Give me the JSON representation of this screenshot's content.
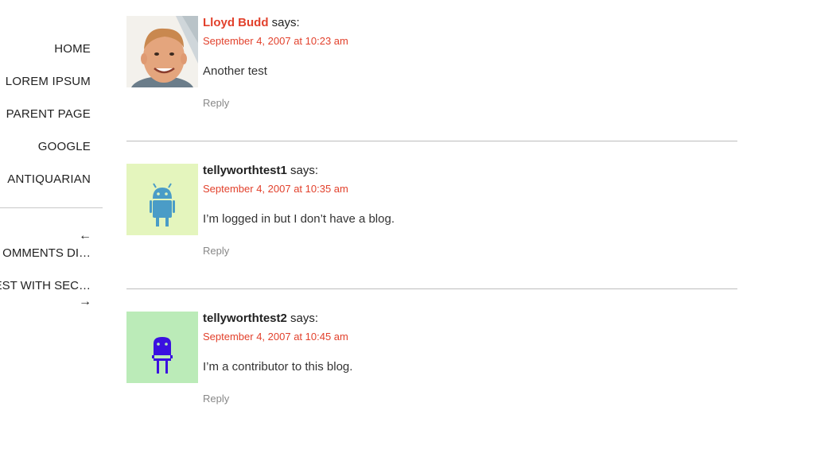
{
  "nav": {
    "items": [
      "HOME",
      "LOREM IPSUM",
      "PARENT PAGE",
      "GOOGLE",
      "ANTIQUARIAN"
    ]
  },
  "post_nav": {
    "prev_arrow": "←",
    "prev_label": "OMMENTS DI…",
    "next_label": "EST WITH SEC…",
    "next_arrow": "→"
  },
  "comments": [
    {
      "author": "Lloyd Budd",
      "says": "says:",
      "date": "September 4, 2007 at 10:23 am",
      "text": "Another test",
      "reply": "Reply",
      "avatar_bg": "#f2efe8"
    },
    {
      "author": "tellyworthtest1",
      "says": "says:",
      "date": "September 4, 2007 at 10:35 am",
      "text": "I’m logged in but I don’t have a blog.",
      "reply": "Reply",
      "avatar_bg": "#e4f5bd",
      "avatar_fg": "#4a9cc7"
    },
    {
      "author": "tellyworthtest2",
      "says": "says:",
      "date": "September 4, 2007 at 10:45 am",
      "text": "I’m a contributor to this blog.",
      "reply": "Reply",
      "avatar_bg": "#bbebb8",
      "avatar_fg": "#3a10e0"
    }
  ]
}
